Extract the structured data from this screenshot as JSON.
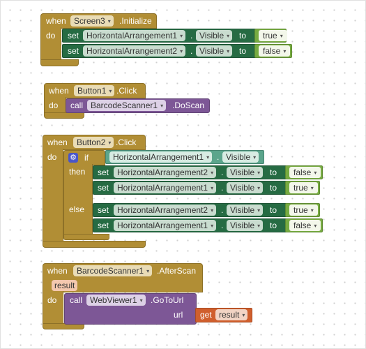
{
  "kw": {
    "when": "when",
    "do": "do",
    "set": "set",
    "to": "to",
    "call": "call",
    "if": "if",
    "then": "then",
    "else": "else",
    "get": "get",
    "dot": "."
  },
  "block1": {
    "component": "Screen3",
    "event": ".Initialize",
    "rows": [
      {
        "component": "HorizontalArrangement1",
        "property": "Visible",
        "value": "true"
      },
      {
        "component": "HorizontalArrangement2",
        "property": "Visible",
        "value": "false"
      }
    ]
  },
  "block2": {
    "component": "Button1",
    "event": ".Click",
    "call_component": "BarcodeScanner1",
    "method": ".DoScan"
  },
  "block3": {
    "component": "Button2",
    "event": ".Click",
    "condition": {
      "component": "HorizontalArrangement1",
      "property": "Visible"
    },
    "then_rows": [
      {
        "component": "HorizontalArrangement2",
        "property": "Visible",
        "value": "false"
      },
      {
        "component": "HorizontalArrangement1",
        "property": "Visible",
        "value": "true"
      }
    ],
    "else_rows": [
      {
        "component": "HorizontalArrangement2",
        "property": "Visible",
        "value": "true"
      },
      {
        "component": "HorizontalArrangement1",
        "property": "Visible",
        "value": "false"
      }
    ]
  },
  "block4": {
    "component": "BarcodeScanner1",
    "event": ".AfterScan",
    "param": "result",
    "call_component": "WebViewer1",
    "method": ".GoToUrl",
    "arg_name": "url",
    "get_var": "result"
  },
  "icons": {
    "gear": "gear-icon",
    "dropdown": "chevron-down-icon"
  },
  "colors": {
    "event": "#b18e35",
    "setter": "#266b43",
    "logic": "#77ab41",
    "component_call": "#7d5796",
    "getter": "#d05f2d",
    "property_getter": "#5ba58c"
  }
}
